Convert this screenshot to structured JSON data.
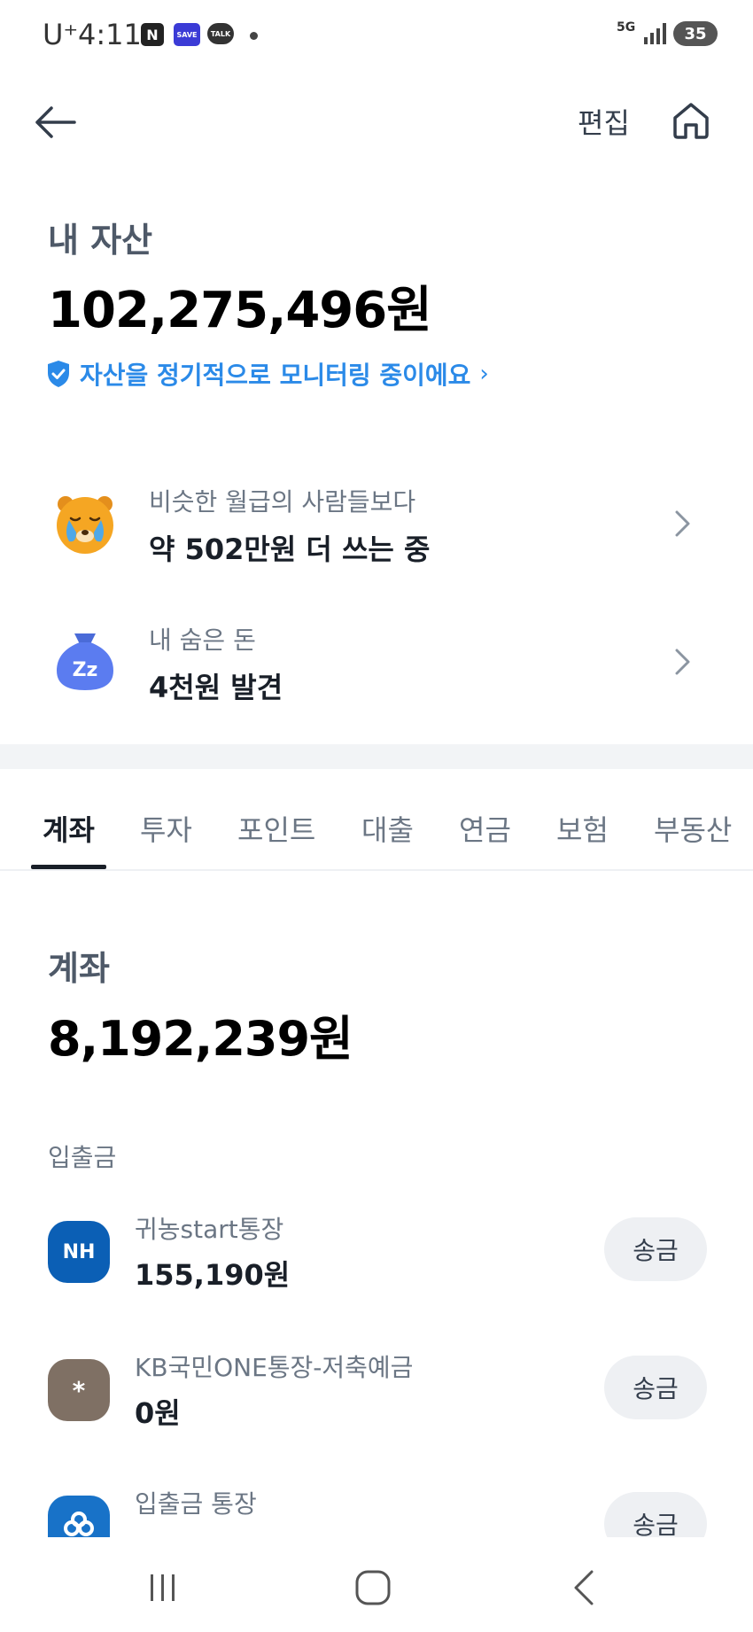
{
  "status_bar": {
    "carrier": "U⁺",
    "time": "4:11",
    "network": "5G",
    "battery": "35",
    "app_icons": [
      "N",
      "SAVE",
      "TALK"
    ]
  },
  "header": {
    "edit_label": "편집"
  },
  "assets": {
    "label": "내 자산",
    "total": "102,275,496원",
    "monitoring_text": "자산을 정기적으로 모니터링 중이에요",
    "monitoring_chevron": "›"
  },
  "insights": [
    {
      "subtitle": "비슷한 월급의 사람들보다",
      "title": "약 502만원 더 쓰는 중",
      "icon": "crying-bear-icon"
    },
    {
      "subtitle": "내 숨은 돈",
      "title": "4천원 발견",
      "icon": "sleeping-pouch-icon",
      "icon_text": "Zz"
    }
  ],
  "tabs": [
    {
      "label": "계좌",
      "active": true
    },
    {
      "label": "투자"
    },
    {
      "label": "포인트"
    },
    {
      "label": "대출"
    },
    {
      "label": "연금"
    },
    {
      "label": "보험"
    },
    {
      "label": "부동산"
    }
  ],
  "account_section": {
    "label": "계좌",
    "total": "8,192,239원",
    "group_label": "입출금"
  },
  "accounts": [
    {
      "logo_text": "NH",
      "name": "귀농start통장",
      "balance": "155,190원",
      "action": "송금",
      "logo_color": "#0b5fb5"
    },
    {
      "logo_text": "*",
      "name": "KB국민ONE통장-저축예금",
      "balance": "0원",
      "action": "송금",
      "logo_color": "#7f7064"
    },
    {
      "logo_text": "",
      "name": "입출금 통장",
      "balance": "",
      "action": "송금",
      "logo_color": "#1872c8"
    }
  ],
  "colors": {
    "accent": "#2b8ae8",
    "text_primary": "#191f28",
    "text_secondary": "#6b7684",
    "button_bg": "#eef0f3"
  }
}
